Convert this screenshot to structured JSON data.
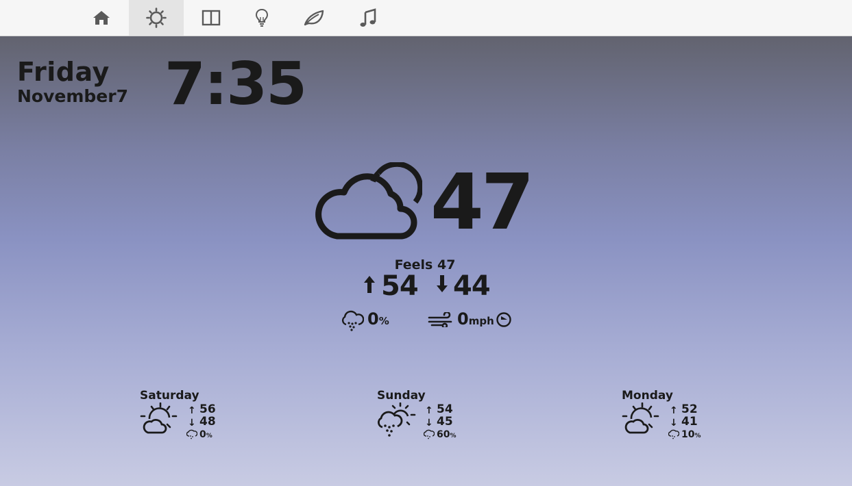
{
  "nav": {
    "tabs": [
      {
        "icon": "home-icon"
      },
      {
        "icon": "sun-icon",
        "active": true
      },
      {
        "icon": "split-panel-icon"
      },
      {
        "icon": "lightbulb-icon"
      },
      {
        "icon": "leaf-icon"
      },
      {
        "icon": "music-note-icon"
      }
    ]
  },
  "clock": {
    "day": "Friday",
    "date": "November7",
    "time": "7:35"
  },
  "current": {
    "condition_icon": "partly-cloudy-icon",
    "temp": "47",
    "feels_label": "Feels 47",
    "high": "54",
    "low": "44",
    "precip": "0",
    "precip_unit": "%",
    "wind": "0",
    "wind_unit": "mph"
  },
  "forecast": [
    {
      "day": "Saturday",
      "icon": "partly-sunny-icon",
      "high": "56",
      "low": "48",
      "precip": "0",
      "precip_unit": "%"
    },
    {
      "day": "Sunday",
      "icon": "rain-sun-icon",
      "high": "54",
      "low": "45",
      "precip": "60",
      "precip_unit": "%"
    },
    {
      "day": "Monday",
      "icon": "partly-sunny-icon",
      "high": "52",
      "low": "41",
      "precip": "10",
      "precip_unit": "%"
    }
  ],
  "colors": {
    "text": "#1a1a1a",
    "nav_bg": "#f6f6f6",
    "nav_active": "#e4e4e4",
    "nav_icon": "#5a5a5a",
    "gradient_top": "#62636f",
    "gradient_bottom": "#c8cbe3"
  }
}
